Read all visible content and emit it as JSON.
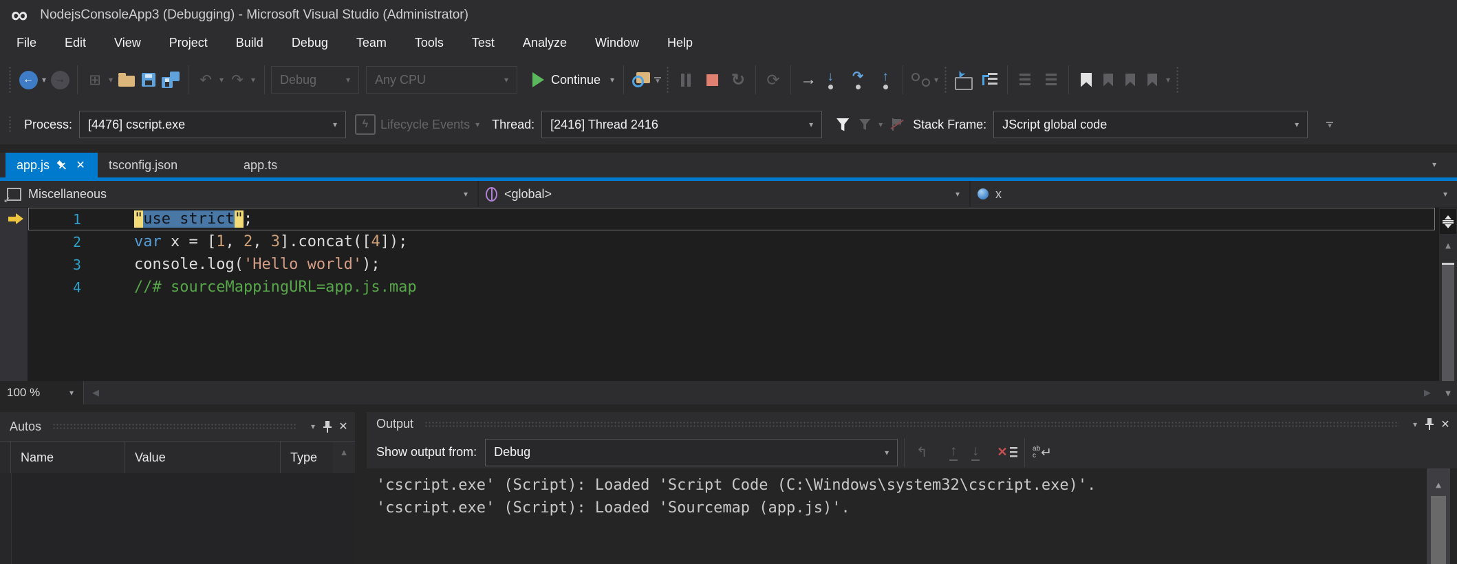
{
  "window": {
    "title": "NodejsConsoleApp3 (Debugging) - Microsoft Visual Studio  (Administrator)"
  },
  "menu": {
    "items": [
      "File",
      "Edit",
      "View",
      "Project",
      "Build",
      "Debug",
      "Team",
      "Tools",
      "Test",
      "Analyze",
      "Window",
      "Help"
    ]
  },
  "toolbar": {
    "debug_config": "Debug",
    "platform": "Any CPU",
    "continue_label": "Continue"
  },
  "debug_bar": {
    "process_label": "Process:",
    "process_value": "[4476] cscript.exe",
    "lifecycle_label": "Lifecycle Events",
    "thread_label": "Thread:",
    "thread_value": "[2416] Thread 2416",
    "stack_frame_label": "Stack Frame:",
    "stack_frame_value": "JScript global code"
  },
  "tabs": [
    {
      "label": "app.js",
      "active": true
    },
    {
      "label": "tsconfig.json",
      "active": false
    },
    {
      "label": "app.ts",
      "active": false
    }
  ],
  "navbar": {
    "project": "Miscellaneous",
    "type": "<global>",
    "member": "x"
  },
  "editor": {
    "zoom_level": "100 %",
    "lines": [
      {
        "number": "1",
        "q1": "\"",
        "sel": "use strict",
        "q2": "\"",
        "tail": ";"
      },
      {
        "number": "2",
        "tokens": [
          {
            "t": "var",
            "c": "kw"
          },
          {
            "t": " x = [",
            "c": "pl"
          },
          {
            "t": "1",
            "c": "num"
          },
          {
            "t": ", ",
            "c": "pl"
          },
          {
            "t": "2",
            "c": "num"
          },
          {
            "t": ", ",
            "c": "pl"
          },
          {
            "t": "3",
            "c": "num"
          },
          {
            "t": "].concat([",
            "c": "pl"
          },
          {
            "t": "4",
            "c": "num"
          },
          {
            "t": "]);",
            "c": "pl"
          }
        ]
      },
      {
        "number": "3",
        "tokens": [
          {
            "t": "console.log(",
            "c": "pl"
          },
          {
            "t": "'Hello world'",
            "c": "str"
          },
          {
            "t": ");",
            "c": "pl"
          }
        ]
      },
      {
        "number": "4",
        "tokens": [
          {
            "t": "//# sourceMappingURL=app.js.map",
            "c": "cmt"
          }
        ]
      }
    ]
  },
  "autos": {
    "title": "Autos",
    "columns": [
      "Name",
      "Value",
      "Type"
    ]
  },
  "output": {
    "title": "Output",
    "show_output_label": "Show output from:",
    "source": "Debug",
    "lines": [
      "'cscript.exe' (Script): Loaded 'Script Code (C:\\Windows\\system32\\cscript.exe)'.",
      "'cscript.exe' (Script): Loaded 'Sourcemap (app.js)'."
    ]
  },
  "colors": {
    "accent": "#007acc",
    "chrome_bg": "#2d2d30",
    "editor_bg": "#1e1e1e",
    "current_statement_highlight": "#f3dc78",
    "selection": "#4a78a6",
    "keyword": "#569cd6",
    "string": "#d69d85",
    "comment": "#57a64a"
  }
}
